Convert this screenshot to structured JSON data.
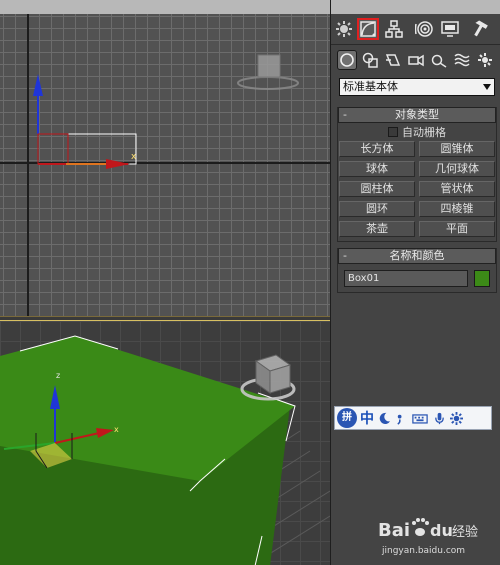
{
  "viewports": {
    "top": {
      "axis_x_label": "x"
    },
    "perspective": {
      "axis_x_label": "x",
      "axis_z_label": "z"
    }
  },
  "command_panel": {
    "tabs": [
      {
        "icon": "create-icon",
        "active": false
      },
      {
        "icon": "modify-icon",
        "active": true
      },
      {
        "icon": "hierarchy-icon",
        "active": false
      },
      {
        "icon": "motion-icon",
        "active": false
      },
      {
        "icon": "display-icon",
        "active": false
      },
      {
        "icon": "utilities-icon",
        "active": false
      }
    ],
    "subcategories": [
      {
        "icon": "geometry-icon",
        "active": true
      },
      {
        "icon": "shapes-icon",
        "active": false
      },
      {
        "icon": "lights-icon",
        "active": false
      },
      {
        "icon": "cameras-icon",
        "active": false
      },
      {
        "icon": "helpers-icon",
        "active": false
      },
      {
        "icon": "space-warps-icon",
        "active": false
      },
      {
        "icon": "systems-icon",
        "active": false
      }
    ],
    "category_dropdown": "标准基本体",
    "object_type": {
      "header": "对象类型",
      "collapse": "-",
      "autogrid_label": "自动栅格",
      "buttons": [
        "长方体",
        "圆锥体",
        "球体",
        "几何球体",
        "圆柱体",
        "管状体",
        "圆环",
        "四棱锥",
        "茶壶",
        "平面"
      ]
    },
    "name_color": {
      "header": "名称和颜色",
      "collapse": "-",
      "name_value": "Box01",
      "swatch_color": "#3c8a17"
    }
  },
  "ime_bar": {
    "logo": "拼",
    "mode": "中",
    "icons": [
      "moon-icon",
      "punctuation-icon",
      "keyboard-icon",
      "microphone-icon",
      "settings-icon"
    ]
  },
  "watermark": {
    "brand": "Bai",
    "brand_suffix": "du",
    "product": "经验",
    "url": "jingyan.baidu.com"
  },
  "colors": {
    "viewport_grid_bg": "#525252",
    "box_green": "#3c8a17",
    "active_tab_border": "#e02020",
    "panel_bg": "#444444"
  }
}
